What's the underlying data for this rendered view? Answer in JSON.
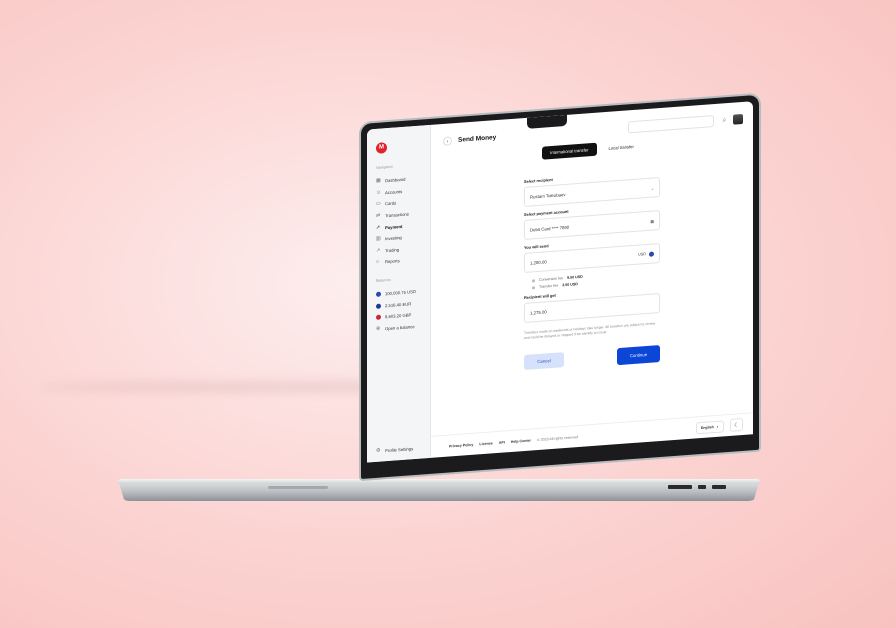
{
  "app": {
    "logo_letter": "M",
    "page_title": "Send Money",
    "accent_color": "#e0242c",
    "primary_color": "#0b46d6"
  },
  "sidebar": {
    "section_navigation": "Navigation",
    "items": [
      {
        "label": "Dashboard",
        "icon": "grid-icon"
      },
      {
        "label": "Accounts",
        "icon": "user-icon"
      },
      {
        "label": "Cards",
        "icon": "card-icon"
      },
      {
        "label": "Transactions",
        "icon": "arrows-icon"
      },
      {
        "label": "Payment",
        "icon": "send-icon"
      },
      {
        "label": "Investing",
        "icon": "chart-icon"
      },
      {
        "label": "Trading",
        "icon": "trend-icon"
      },
      {
        "label": "Reports",
        "icon": "report-icon"
      }
    ],
    "section_balances": "Balances",
    "balances": [
      {
        "label": "100,000.75 USD",
        "color": "#2b4aa8"
      },
      {
        "label": "2,516.40 EUR",
        "color": "#1a3a9a"
      },
      {
        "label": "8,603.20 GBP",
        "color": "#c8283a"
      }
    ],
    "open_balance": "Open a balance",
    "profile_settings": "Profile Settings"
  },
  "tabs": [
    {
      "label": "International transfer",
      "active": true
    },
    {
      "label": "Local transfer",
      "active": false
    }
  ],
  "form": {
    "recipient_label": "Select recipient",
    "recipient_value": "Rustam Toleubaev",
    "account_label": "Select payment account",
    "account_value": "Debit Card **** 7890",
    "send_label": "You will send",
    "send_value": "1,280.00",
    "send_currency": "USD",
    "fee1_label": "Conversion fee",
    "fee1_value": "9.50 USD",
    "fee2_label": "Transfer fee",
    "fee2_value": "3.50 USD",
    "get_label": "Recipient will get",
    "get_value": "1,275.00",
    "note": "Transfers made on weekends or holidays take longer. All transfers are subject to review and could be delayed or stopped if we identify an issue."
  },
  "buttons": {
    "cancel": "Cancel",
    "continue": "Continue"
  },
  "footer": {
    "links": [
      "Privacy Policy",
      "License",
      "API",
      "Help Center"
    ],
    "copyright": "© 2023 All rights reserved",
    "language": "English"
  }
}
